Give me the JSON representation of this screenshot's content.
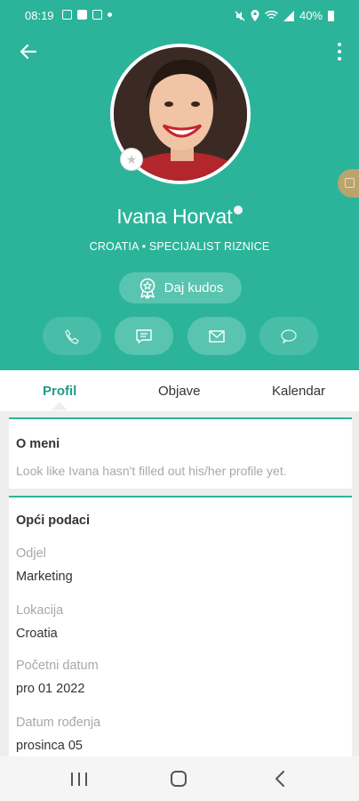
{
  "status_bar": {
    "time": "08:19",
    "battery": "40%",
    "icons": [
      "image-icon",
      "video-icon",
      "gallery-icon",
      "notification-dot",
      "mute-icon",
      "location-icon",
      "wifi-icon",
      "signal-icon",
      "battery-icon"
    ]
  },
  "profile": {
    "name": "Ivana Horvat",
    "subtitle": "CROATIA • SPECIJALIST RIZNICE",
    "kudos_label": "Daj kudos",
    "actions": [
      "phone-icon",
      "chat-icon",
      "mail-icon",
      "comment-icon"
    ]
  },
  "tabs": [
    {
      "label": "Profil",
      "active": true
    },
    {
      "label": "Objave",
      "active": false
    },
    {
      "label": "Kalendar",
      "active": false
    }
  ],
  "about": {
    "title": "O meni",
    "text": "Look like Ivana hasn't filled out his/her profile yet."
  },
  "general": {
    "title": "Opći podaci",
    "fields": [
      {
        "label": "Odjel",
        "value": "Marketing"
      },
      {
        "label": "Lokacija",
        "value": "Croatia"
      },
      {
        "label": "Početni datum",
        "value": "pro 01 2022"
      },
      {
        "label": "Datum rođenja",
        "value": "prosinca 05"
      }
    ]
  },
  "colors": {
    "accent": "#2bb49a",
    "accent_text": "#1f9c87",
    "muted_text": "#a8a8a8"
  }
}
